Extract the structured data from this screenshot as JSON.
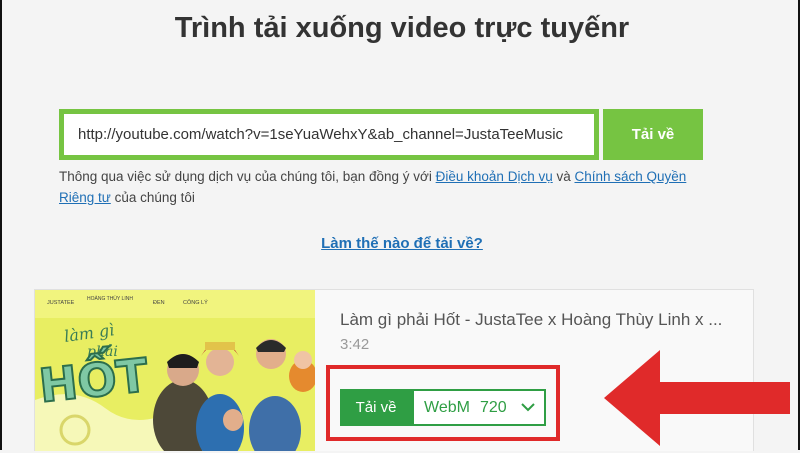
{
  "page": {
    "title": "Trình tải xuống video trực tuyếnr"
  },
  "search": {
    "value": "http://youtube.com/watch?v=1seYuaWehxY&ab_channel=JustaTeeMusic",
    "button_label": "Tải về"
  },
  "terms": {
    "prefix": "Thông qua việc sử dụng dịch vụ của chúng tôi, bạn đồng ý với ",
    "terms_link": "Điều khoản Dịch vụ",
    "and": " và ",
    "privacy_link": "Chính sách Quyền Riêng tư",
    "suffix": " của chúng tôi"
  },
  "howto_link": "Làm thế nào để tải về?",
  "video": {
    "title": "Làm gì phải Hốt - JustaTee x Hoàng Thùy Linh x ...",
    "duration": "3:42",
    "thumbnail": {
      "artists": [
        "JUSTATEE",
        "HOÀNG THÙY LINH",
        "ĐEN",
        "CÔNG LÝ"
      ],
      "logo_text": "làm gì phải HỐT"
    }
  },
  "download": {
    "button_label": "Tải về",
    "format": "WebM",
    "quality": "720"
  },
  "colors": {
    "accent_green": "#76c442",
    "button_green": "#2f9e44",
    "link_blue": "#1f6fb5",
    "highlight_red": "#e02a2a"
  },
  "icons": {
    "format_dropdown": "chevron-down-icon",
    "pointer": "red-arrow-left-icon"
  }
}
